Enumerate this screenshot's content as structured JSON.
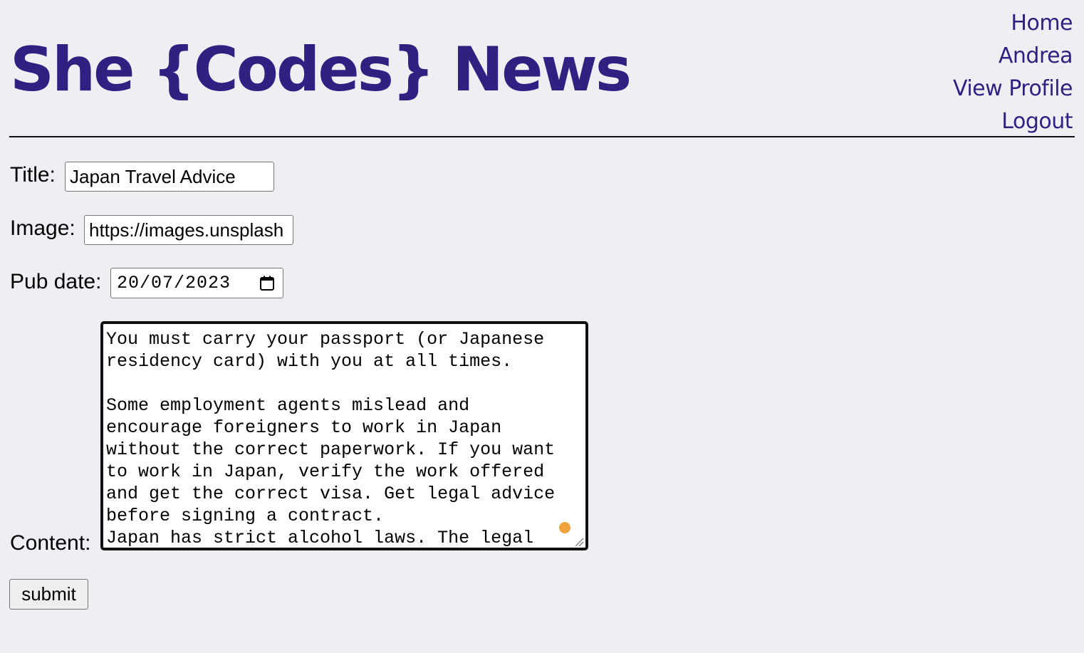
{
  "header": {
    "site_title": "She {Codes} News",
    "brand_color": "#2e2181"
  },
  "nav": {
    "items": [
      {
        "label": "Home"
      },
      {
        "label": "Andrea"
      },
      {
        "label": "View Profile"
      },
      {
        "label": "Logout"
      }
    ]
  },
  "form": {
    "title_label": "Title:",
    "title_value": "Japan Travel Advice",
    "image_label": "Image:",
    "image_value": "https://images.unsplash",
    "pub_date_label": "Pub date:",
    "pub_date_value": "20/07/2023",
    "content_label": "Content:",
    "content_value": "You must carry your passport (or Japanese\nresidency card) with you at all times.\n\nSome employment agents mislead and\nencourage foreigners to work in Japan\nwithout the correct paperwork. If you want\nto work in Japan, verify the work offered\nand get the correct visa. Get legal advice\nbefore signing a contract.\nJapan has strict alcohol laws. The legal",
    "submit_label": "submit"
  },
  "icons": {
    "calendar": "calendar-icon",
    "resize": "resize-handle-icon"
  },
  "colors": {
    "background": "#efeef2",
    "indicator": "#f0a43b"
  }
}
